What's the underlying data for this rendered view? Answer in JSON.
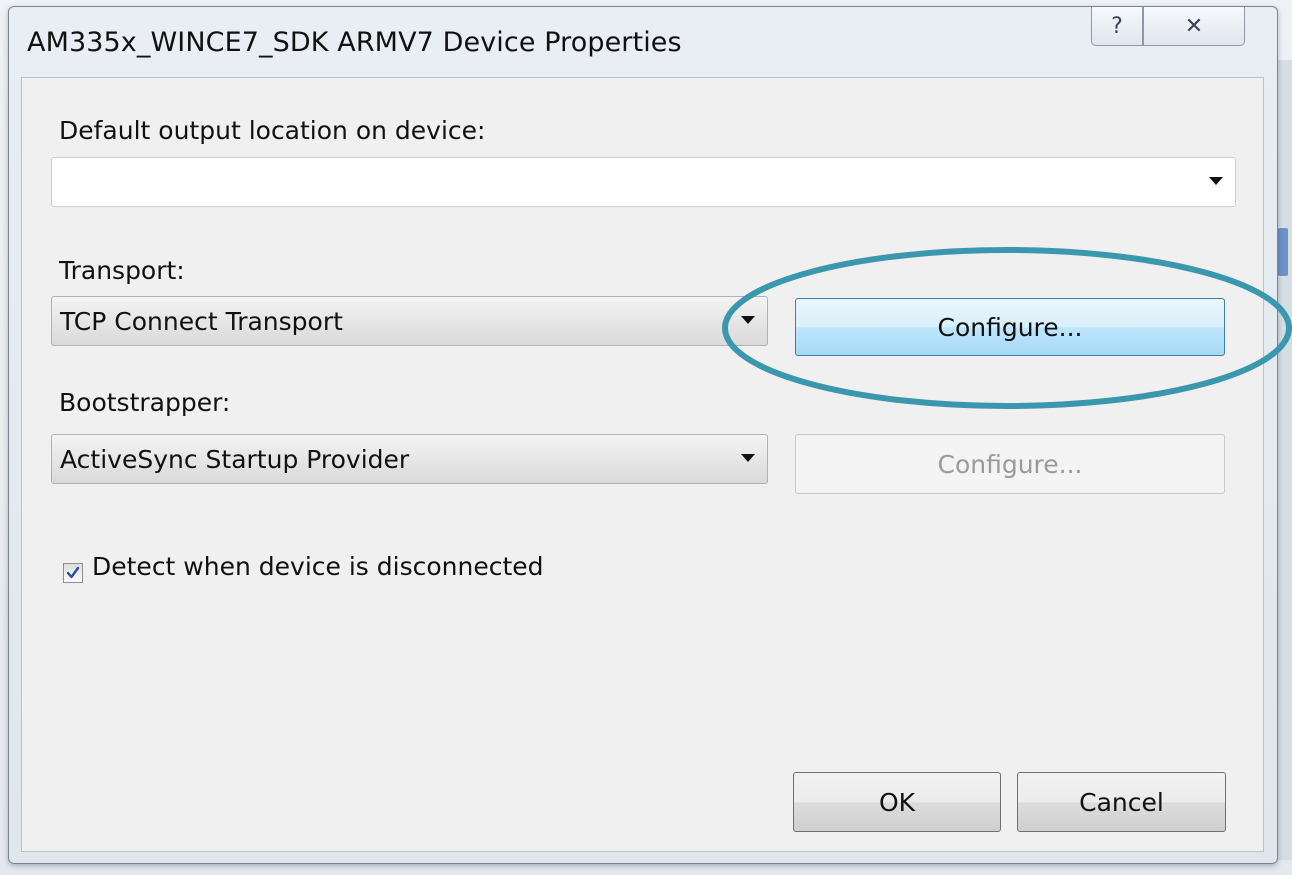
{
  "window": {
    "title": "AM335x_WINCE7_SDK ARMV7 Device Properties",
    "help_glyph": "?",
    "close_glyph": "✕"
  },
  "output_location": {
    "label": "Default output location on device:",
    "value": ""
  },
  "transport": {
    "label": "Transport:",
    "selected": "TCP Connect Transport",
    "configure_label": "Configure..."
  },
  "bootstrapper": {
    "label": "Bootstrapper:",
    "selected": "ActiveSync Startup Provider",
    "configure_label": "Configure..."
  },
  "detect_disconnect": {
    "label": "Detect when device is disconnected",
    "checked": true
  },
  "footer": {
    "ok_label": "OK",
    "cancel_label": "Cancel"
  },
  "colors": {
    "highlight_ellipse": "#3a97ad",
    "hot_button": "#bee6fd",
    "checkmark": "#2a4e9c"
  }
}
